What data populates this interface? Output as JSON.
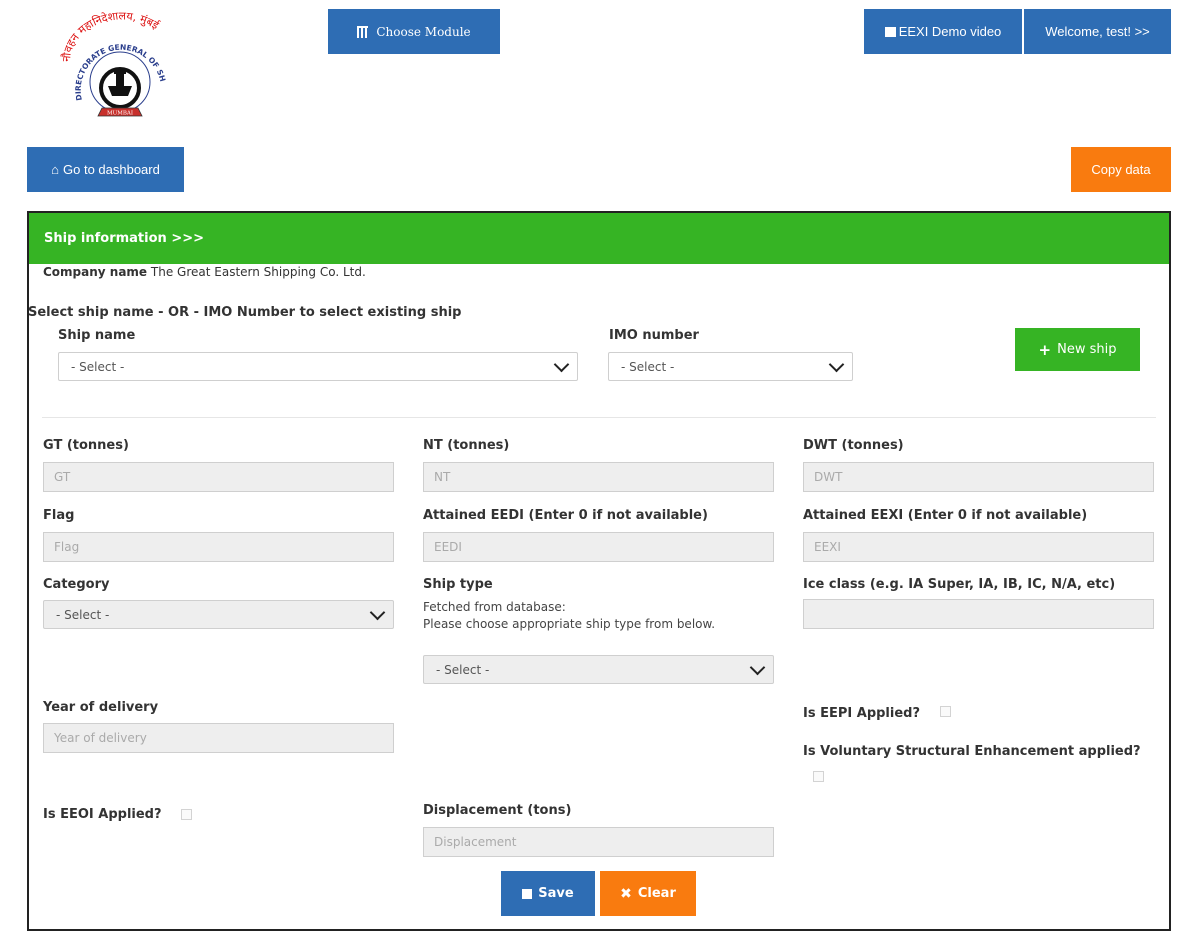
{
  "header": {
    "logo": {
      "text_top": "नौवहन महानिदेशालय, मुंबई",
      "text_ring": "DIRECTORATE GENERAL OF SHIPPING",
      "text_banner": "MUMBAI"
    },
    "choose_module_label": "Choose Module",
    "demo_video_label": "EEXI Demo video",
    "welcome_label": "Welcome, test! >>",
    "dashboard_label": "Go to dashboard",
    "copy_data_label": "Copy data"
  },
  "panel": {
    "title": "Ship information >>>",
    "company_label": "Company name",
    "company_value": "The Great Eastern Shipping Co. Ltd.",
    "select_hint": "Select ship name - OR - IMO Number to select existing ship",
    "ship_name_label": "Ship name",
    "ship_name_value": "- Select -",
    "imo_label": "IMO number",
    "imo_value": "- Select -",
    "new_ship_label": "New ship"
  },
  "form": {
    "gt_label": "GT (tonnes)",
    "gt_placeholder": "GT",
    "nt_label": "NT (tonnes)",
    "nt_placeholder": "NT",
    "dwt_label": "DWT (tonnes)",
    "dwt_placeholder": "DWT",
    "flag_label": "Flag",
    "flag_placeholder": "Flag",
    "eedi_label": "Attained EEDI (Enter 0 if not available)",
    "eedi_placeholder": "EEDI",
    "eexi_label": "Attained EEXI (Enter 0 if not available)",
    "eexi_placeholder": "EEXI",
    "category_label": "Category",
    "category_value": "- Select -",
    "ship_type_label": "Ship type",
    "ship_type_note1": "Fetched from database:",
    "ship_type_note2": "Please choose appropriate ship type from below.",
    "ship_type_value": "- Select -",
    "ice_class_label": "Ice class (e.g. IA Super, IA, IB, IC, N/A, etc)",
    "year_label": "Year of delivery",
    "year_placeholder": "Year of delivery",
    "eepi_label": "Is EEPI Applied?",
    "vse_label": "Is Voluntary Structural Enhancement applied?",
    "eeoi_label": "Is EEOI Applied?",
    "displacement_label": "Displacement (tons)",
    "displacement_placeholder": "Displacement",
    "save_label": "Save",
    "clear_label": "Clear"
  }
}
